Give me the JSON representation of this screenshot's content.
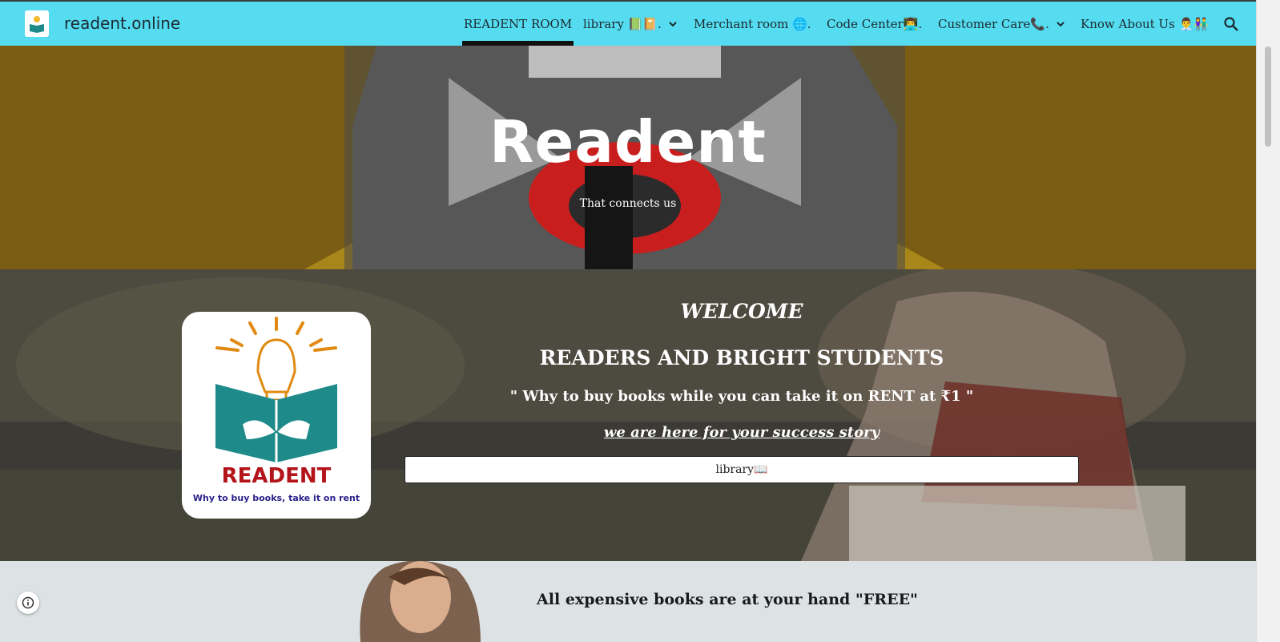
{
  "site": {
    "title": "readent.online"
  },
  "nav": {
    "items": [
      {
        "label": "READENT ROOM"
      },
      {
        "label": "library 📗📔."
      },
      {
        "label": "Merchant room 🌐."
      },
      {
        "label": "Code Center👨‍💻."
      },
      {
        "label": "Customer Care📞."
      },
      {
        "label": "Know About Us 👨‍💼👫"
      }
    ]
  },
  "hero": {
    "title": "Readent",
    "subtitle": "That connects us"
  },
  "welcome": {
    "line1": "WELCOME",
    "line2": "READERS AND BRIGHT STUDENTS",
    "line3": "\" Why to buy books while you can take it on RENT at ₹1 \"",
    "line4": "we are here for your success story",
    "button_label": "library📖"
  },
  "logo": {
    "word": "READENT",
    "tagline": "Why to buy books, take it on rent"
  },
  "lower": {
    "text": "All expensive books are at your hand \"FREE\""
  },
  "colors": {
    "nav_bg": "#55dcf0",
    "hero_bg": "#8a6a14",
    "logo_red": "#b3141a",
    "logo_teal": "#1e8a8a"
  }
}
